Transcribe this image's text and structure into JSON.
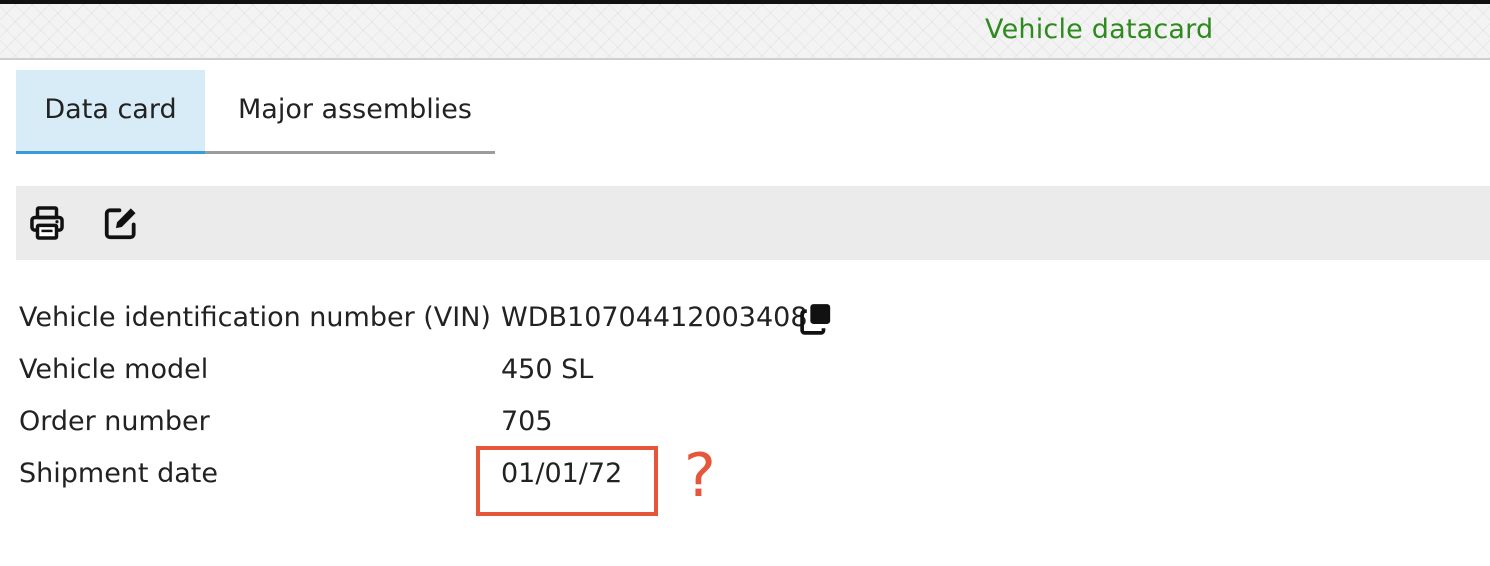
{
  "header": {
    "title": "Vehicle datacard"
  },
  "tabs": [
    {
      "label": "Data card",
      "active": true
    },
    {
      "label": "Major assemblies",
      "active": false
    }
  ],
  "toolbar": {
    "buttons": [
      {
        "icon": "printer-icon"
      },
      {
        "icon": "edit-icon"
      }
    ]
  },
  "details": [
    {
      "label": "Vehicle identification number (VIN)",
      "value": "WDB10704412003408"
    },
    {
      "label": "Vehicle model",
      "value": "450 SL"
    },
    {
      "label": "Order number",
      "value": "705"
    },
    {
      "label": "Shipment date",
      "value": "01/01/72"
    }
  ],
  "annotation": {
    "mark": "?",
    "color": "#e6563a"
  },
  "colors": {
    "title_green": "#2e8a1e",
    "active_tab_bg": "#d7ecf7",
    "active_tab_underline": "#3a9bd6",
    "toolbar_bg": "#ebebeb"
  }
}
